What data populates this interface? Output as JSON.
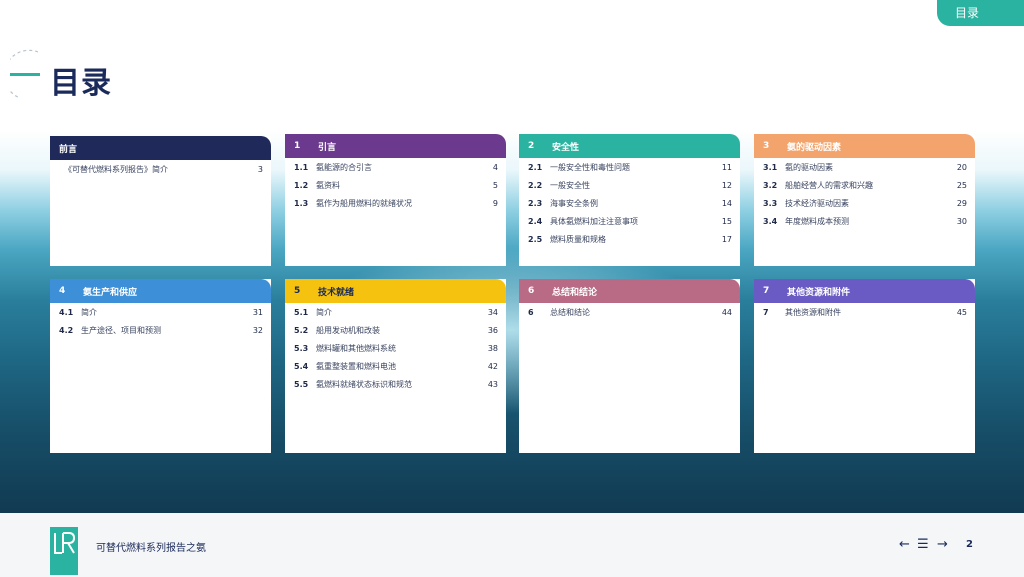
{
  "tab": {
    "label": "目录"
  },
  "page_title": "目录",
  "sections": [
    {
      "num": "",
      "title": "前言",
      "color": "#1f2a5a",
      "items": [
        {
          "num": "",
          "text": "《可替代燃料系列报告》简介",
          "page": "3"
        }
      ]
    },
    {
      "num": "1",
      "title": "引言",
      "color": "#6b3a8e",
      "items": [
        {
          "num": "1.1",
          "text": "氨能源的合引言",
          "page": "4"
        },
        {
          "num": "1.2",
          "text": "氨资料",
          "page": "5"
        },
        {
          "num": "1.3",
          "text": "氨作为船用燃料的就绪状况",
          "page": "9"
        }
      ]
    },
    {
      "num": "2",
      "title": "安全性",
      "color": "#2ab3a0",
      "items": [
        {
          "num": "2.1",
          "text": "一般安全性和毒性问题",
          "page": "11"
        },
        {
          "num": "2.2",
          "text": "一般安全性",
          "page": "12"
        },
        {
          "num": "2.3",
          "text": "海事安全条例",
          "page": "14"
        },
        {
          "num": "2.4",
          "text": "具体氨燃料加注注意事项",
          "page": "15"
        },
        {
          "num": "2.5",
          "text": "燃料质量和规格",
          "page": "17"
        }
      ]
    },
    {
      "num": "3",
      "title": "氨的驱动因素",
      "color": "#f2a46c",
      "items": [
        {
          "num": "3.1",
          "text": "氨的驱动因素",
          "page": "20"
        },
        {
          "num": "3.2",
          "text": "船舶经营人的需求和兴趣",
          "page": "25"
        },
        {
          "num": "3.3",
          "text": "技术经济驱动因素",
          "page": "29"
        },
        {
          "num": "3.4",
          "text": "年度燃料成本预测",
          "page": "30"
        }
      ]
    },
    {
      "num": "4",
      "title": "氨生产和供应",
      "color": "#3d8fd8",
      "items": [
        {
          "num": "4.1",
          "text": "简介",
          "page": "31"
        },
        {
          "num": "4.2",
          "text": "生产途径、项目和预测",
          "page": "32"
        }
      ]
    },
    {
      "num": "5",
      "title": "技术就绪",
      "color": "#f5c20f",
      "items": [
        {
          "num": "5.1",
          "text": "简介",
          "page": "34"
        },
        {
          "num": "5.2",
          "text": "船用发动机和改装",
          "page": "36"
        },
        {
          "num": "5.3",
          "text": "燃料罐和其他燃料系统",
          "page": "38"
        },
        {
          "num": "5.4",
          "text": "氨重整装置和燃料电池",
          "page": "42"
        },
        {
          "num": "5.5",
          "text": "氨燃料就绪状态标识和规范",
          "page": "43"
        }
      ]
    },
    {
      "num": "6",
      "title": "总结和结论",
      "color": "#b96a85",
      "items": [
        {
          "num": "6",
          "text": "总结和结论",
          "page": "44"
        }
      ]
    },
    {
      "num": "7",
      "title": "其他资源和附件",
      "color": "#6a5bc4",
      "items": [
        {
          "num": "7",
          "text": "其他资源和附件",
          "page": "45"
        }
      ]
    }
  ],
  "footer": {
    "title": "可替代燃料系列报告之氨",
    "prev_icon": "arrow-left-icon",
    "menu_icon": "menu-icon",
    "next_icon": "arrow-right-icon",
    "page_number": "2"
  }
}
